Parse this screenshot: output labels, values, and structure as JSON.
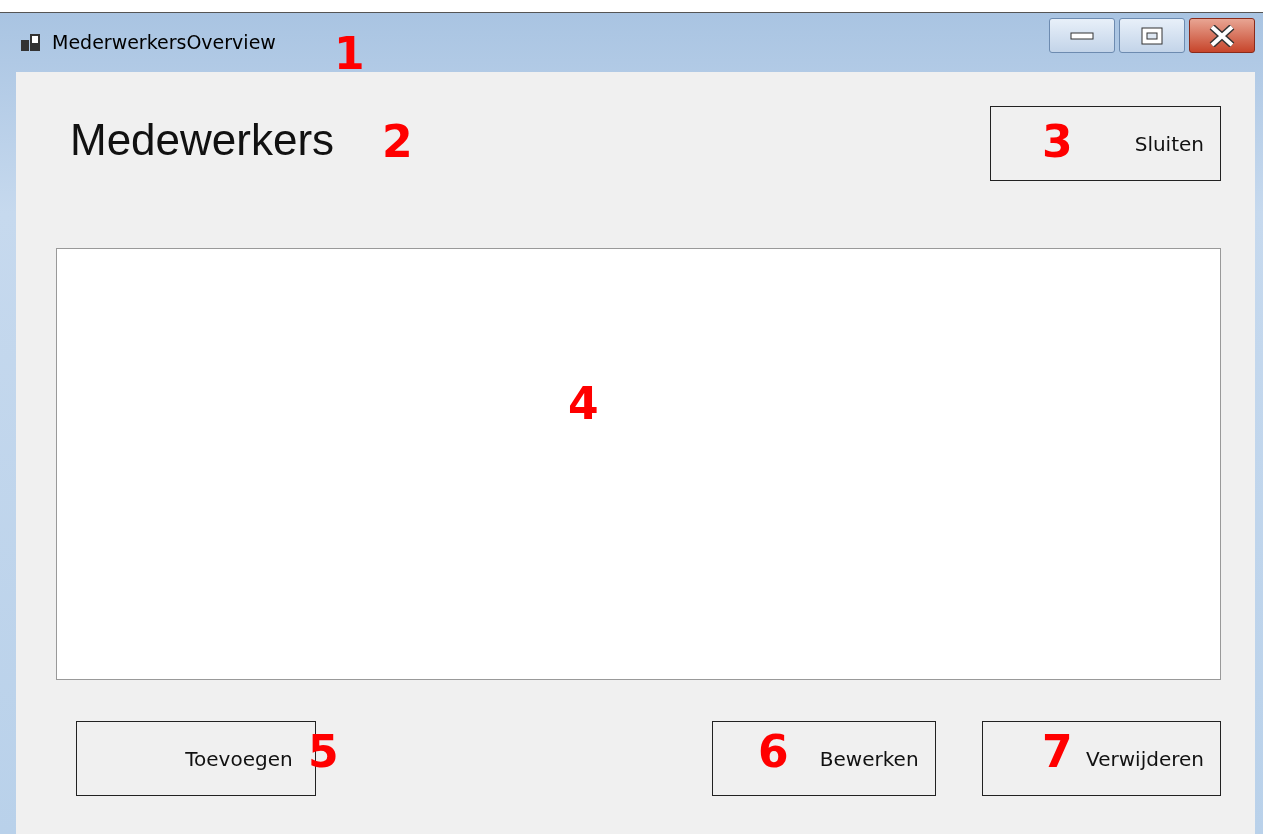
{
  "window": {
    "title": "MederwerkersOverview"
  },
  "heading": "Medewerkers",
  "close_button": "Sluiten",
  "buttons": [
    "Toevoegen",
    "Bewerken",
    "Verwijderen"
  ],
  "annotations": [
    {
      "label": "1"
    },
    {
      "label": "2"
    },
    {
      "label": "3"
    },
    {
      "label": "4"
    },
    {
      "label": "5"
    },
    {
      "label": "6"
    },
    {
      "label": "7"
    }
  ]
}
